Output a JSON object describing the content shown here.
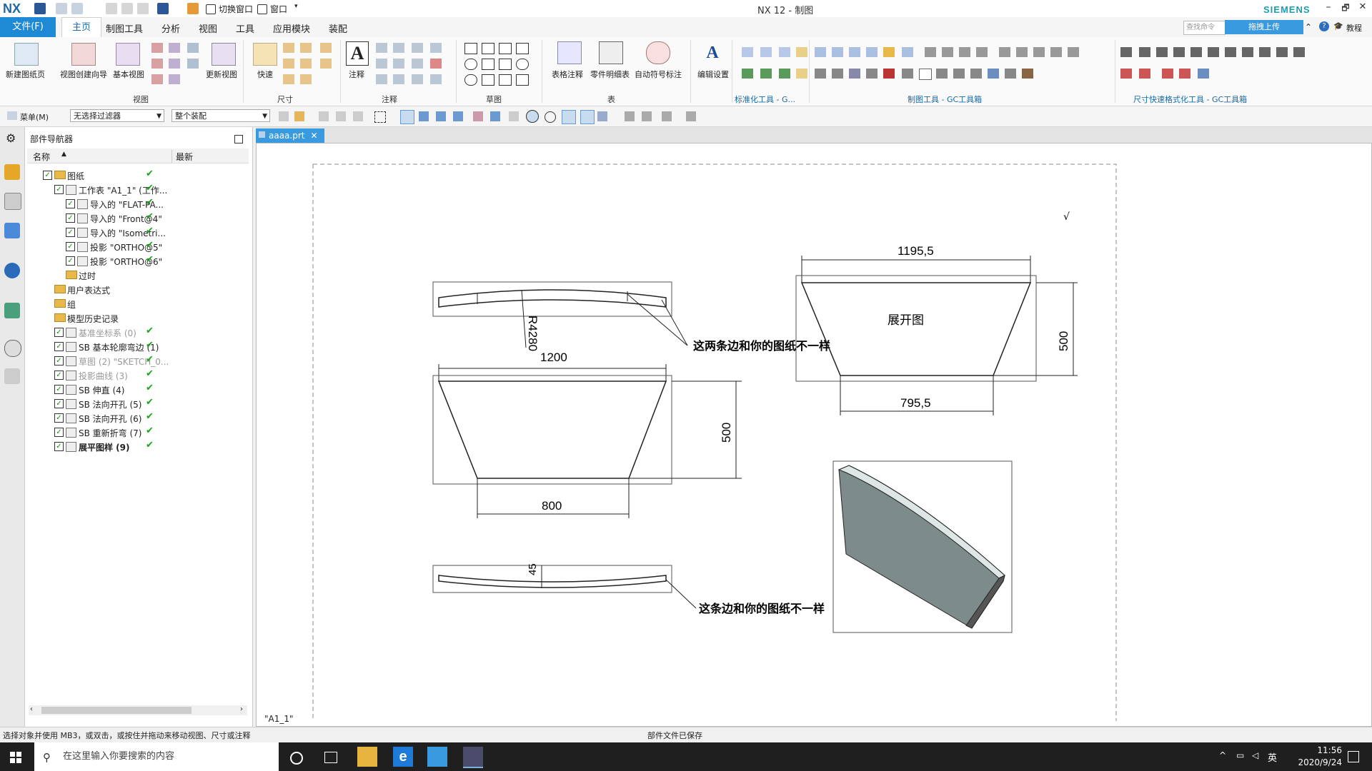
{
  "titlebar": {
    "logo": "NX",
    "switch_window": "切换窗口",
    "window_menu": "窗口",
    "title": "NX 12 - 制图",
    "brand": "SIEMENS",
    "minimize": "–",
    "restore": "🗗",
    "close": "✕"
  },
  "menubar": {
    "file": "文件(F)",
    "tabs": [
      "主页",
      "制图工具",
      "分析",
      "视图",
      "工具",
      "应用模块",
      "装配"
    ],
    "search_placeholder": "查找命令",
    "upload": "拖拽上传",
    "tutorial": "教程"
  },
  "ribbon": {
    "new_sheet": "新建图纸页",
    "view_wizard": "视图创建向导",
    "base_view": "基本视图",
    "update_view": "更新视图",
    "quick": "快速",
    "note": "注释",
    "table_note": "表格注释",
    "parts_list": "零件明细表",
    "auto_balloon": "自动符号标注",
    "edit_settings": "编辑设置",
    "groups": {
      "view": "视图",
      "dimension": "尺寸",
      "annotation": "注释",
      "sketch": "草图",
      "table": "表",
      "std_tools": "标准化工具 - G...",
      "drafting_tools": "制图工具 - GC工具箱",
      "dim_format": "尺寸快速格式化工具 - GC工具箱"
    }
  },
  "toolbar": {
    "menu": "菜单(M)",
    "filter": "无选择过滤器",
    "assembly": "整个装配"
  },
  "navigator": {
    "title": "部件导航器",
    "col_name": "名称",
    "col_latest": "最新",
    "items": [
      {
        "label": "图纸",
        "level": 0,
        "check": true
      },
      {
        "label": "工作表 \"A1_1\" (工作...",
        "level": 1,
        "check": true
      },
      {
        "label": "导入的 \"FLAT-PA...",
        "level": 2,
        "check": true
      },
      {
        "label": "导入的 \"Front@4\"",
        "level": 2,
        "check": true
      },
      {
        "label": "导入的 \"Isometri...",
        "level": 2,
        "check": true
      },
      {
        "label": "投影 \"ORTHO@5\"",
        "level": 2,
        "check": true
      },
      {
        "label": "投影 \"ORTHO@6\"",
        "level": 2,
        "check": true
      },
      {
        "label": "过时",
        "level": 1,
        "check": false
      },
      {
        "label": "用户表达式",
        "level": 0,
        "check": false
      },
      {
        "label": "组",
        "level": 0,
        "check": false
      },
      {
        "label": "模型历史记录",
        "level": 0,
        "check": false
      },
      {
        "label": "基准坐标系 (0)",
        "level": 1,
        "check": true,
        "grey": true
      },
      {
        "label": "SB 基本轮廓弯边 (1)",
        "level": 1,
        "check": true
      },
      {
        "label": "草图 (2) \"SKETCH_0...",
        "level": 1,
        "check": true,
        "grey": true
      },
      {
        "label": "投影曲线 (3)",
        "level": 1,
        "check": true,
        "grey": true
      },
      {
        "label": "SB 伸直 (4)",
        "level": 1,
        "check": true
      },
      {
        "label": "SB 法向开孔 (5)",
        "level": 1,
        "check": true
      },
      {
        "label": "SB 法向开孔 (6)",
        "level": 1,
        "check": true
      },
      {
        "label": "SB 重新折弯 (7)",
        "level": 1,
        "check": true
      },
      {
        "label": "展平图样 (9)",
        "level": 1,
        "check": true,
        "bold": true
      }
    ]
  },
  "document": {
    "tab": "aaaa.prt",
    "sheet": "\"A1_1\""
  },
  "drawing": {
    "dim_top_width": "1195,5",
    "dim_flat_height": "500",
    "dim_flat_bottom": "795,5",
    "flat_label": "展开图",
    "dim_radius": "R4280",
    "dim_front_width": "1200",
    "dim_front_height": "500",
    "dim_front_bottom": "800",
    "dim_thickness": "45",
    "note_1": "这两条边和你的图纸不一样",
    "note_2": "这条边和你的图纸不一样",
    "check_mark": "√"
  },
  "status": {
    "hint": "选择对象并使用 MB3，或双击，或按住并拖动来移动视图、尺寸或注释",
    "saved": "部件文件已保存"
  },
  "taskbar": {
    "search_placeholder": "在这里输入你要搜索的内容",
    "time": "11:56",
    "date": "2020/9/24",
    "ime": "英"
  },
  "colors": {
    "accent": "#1e8ad6",
    "brand": "#1a9fb3",
    "check": "#1fa01f"
  }
}
